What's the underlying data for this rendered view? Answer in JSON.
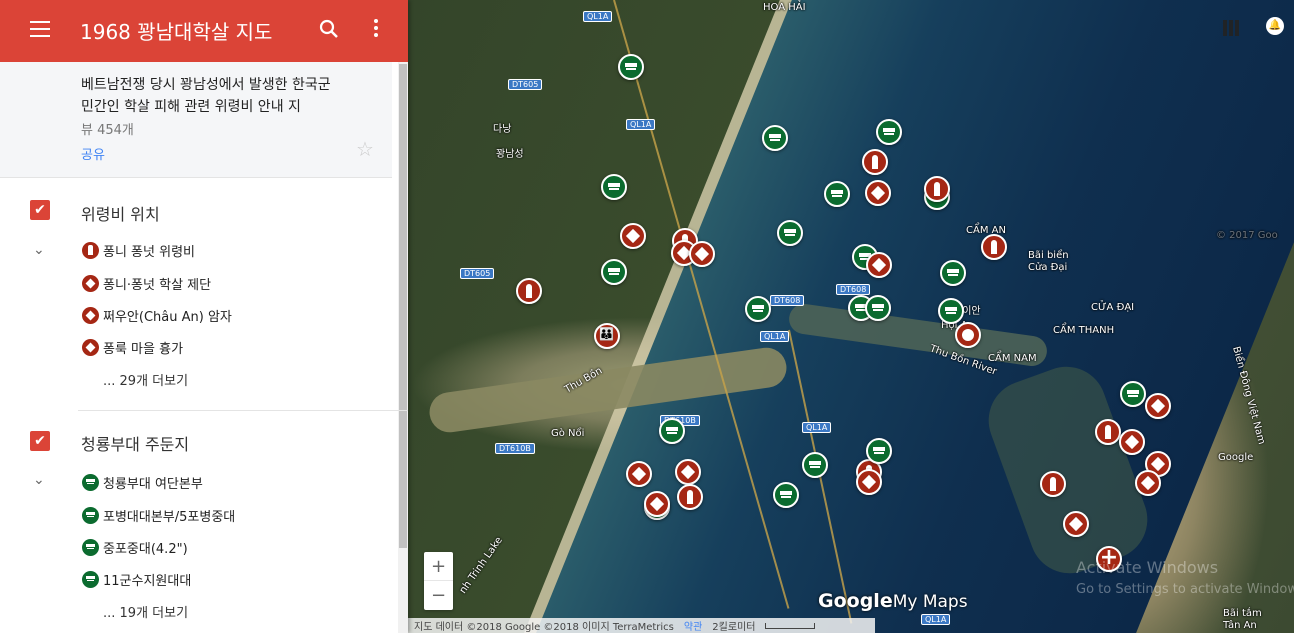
{
  "header": {
    "title": "1968 꽝남대학살 지도"
  },
  "description": {
    "text": "베트남전쟁 당시 꽝남성에서 발생한 한국군 민간인 학살 피해 관련 위령비 안내 지",
    "views": "뷰 454개",
    "share": "공유"
  },
  "layers": [
    {
      "name": "위령비 위치",
      "items": [
        "퐁니 퐁넛 위령비",
        "퐁니·퐁넛 학살 제단",
        "쩌우안(Châu An) 암자",
        "퐁룩 마을 흉가"
      ],
      "more": "... 29개 더보기"
    },
    {
      "name": "청룡부대 주둔지",
      "items": [
        "청룡부대 여단본부",
        "포병대대본부/5포병중대",
        "중포중대(4.2\")",
        "11군수지원대대"
      ],
      "more": "... 19개 더보기"
    }
  ],
  "map": {
    "labels": [
      "HOA HẢI",
      "다낭",
      "꽝남성",
      "Gò Nổi",
      "호이안",
      "Hội An",
      "CẨM AN",
      "Bãi biển",
      "Cửa Đại",
      "CỬA ĐẠI",
      "CẨM THANH",
      "CẨM NAM",
      "Thu Bồn River",
      "Biển Đông Việt Nam",
      "Bãi tắm",
      "Tân An",
      "Thu Bồn",
      "nh Trinh Lake",
      "© 2017 Goo",
      "Google"
    ],
    "shields": [
      "QL1A",
      "DT605",
      "QL1A",
      "DT605",
      "DT608",
      "DT608",
      "QL1A",
      "DT610B",
      "DT610B",
      "QL1A",
      "QL1A"
    ],
    "watermark": [
      "Activate Windows",
      "Go to Settings to activate Windows"
    ],
    "zoom_in": "+",
    "zoom_out": "−",
    "logo": "Google",
    "logo_suffix": "My Maps",
    "attribution": "지도 데이터 ©2018 Google ©2018 이미지 TerraMetrics",
    "terms": "약관",
    "scale": "2킬로미터"
  }
}
